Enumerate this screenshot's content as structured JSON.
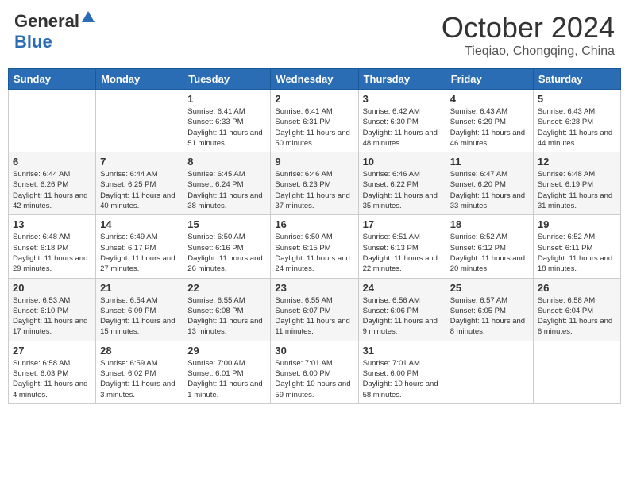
{
  "header": {
    "logo_general": "General",
    "logo_blue": "Blue",
    "month_title": "October 2024",
    "location": "Tieqiao, Chongqing, China"
  },
  "days_of_week": [
    "Sunday",
    "Monday",
    "Tuesday",
    "Wednesday",
    "Thursday",
    "Friday",
    "Saturday"
  ],
  "weeks": [
    [
      {
        "day": "",
        "sunrise": "",
        "sunset": "",
        "daylight": ""
      },
      {
        "day": "",
        "sunrise": "",
        "sunset": "",
        "daylight": ""
      },
      {
        "day": "1",
        "sunrise": "Sunrise: 6:41 AM",
        "sunset": "Sunset: 6:33 PM",
        "daylight": "Daylight: 11 hours and 51 minutes."
      },
      {
        "day": "2",
        "sunrise": "Sunrise: 6:41 AM",
        "sunset": "Sunset: 6:31 PM",
        "daylight": "Daylight: 11 hours and 50 minutes."
      },
      {
        "day": "3",
        "sunrise": "Sunrise: 6:42 AM",
        "sunset": "Sunset: 6:30 PM",
        "daylight": "Daylight: 11 hours and 48 minutes."
      },
      {
        "day": "4",
        "sunrise": "Sunrise: 6:43 AM",
        "sunset": "Sunset: 6:29 PM",
        "daylight": "Daylight: 11 hours and 46 minutes."
      },
      {
        "day": "5",
        "sunrise": "Sunrise: 6:43 AM",
        "sunset": "Sunset: 6:28 PM",
        "daylight": "Daylight: 11 hours and 44 minutes."
      }
    ],
    [
      {
        "day": "6",
        "sunrise": "Sunrise: 6:44 AM",
        "sunset": "Sunset: 6:26 PM",
        "daylight": "Daylight: 11 hours and 42 minutes."
      },
      {
        "day": "7",
        "sunrise": "Sunrise: 6:44 AM",
        "sunset": "Sunset: 6:25 PM",
        "daylight": "Daylight: 11 hours and 40 minutes."
      },
      {
        "day": "8",
        "sunrise": "Sunrise: 6:45 AM",
        "sunset": "Sunset: 6:24 PM",
        "daylight": "Daylight: 11 hours and 38 minutes."
      },
      {
        "day": "9",
        "sunrise": "Sunrise: 6:46 AM",
        "sunset": "Sunset: 6:23 PM",
        "daylight": "Daylight: 11 hours and 37 minutes."
      },
      {
        "day": "10",
        "sunrise": "Sunrise: 6:46 AM",
        "sunset": "Sunset: 6:22 PM",
        "daylight": "Daylight: 11 hours and 35 minutes."
      },
      {
        "day": "11",
        "sunrise": "Sunrise: 6:47 AM",
        "sunset": "Sunset: 6:20 PM",
        "daylight": "Daylight: 11 hours and 33 minutes."
      },
      {
        "day": "12",
        "sunrise": "Sunrise: 6:48 AM",
        "sunset": "Sunset: 6:19 PM",
        "daylight": "Daylight: 11 hours and 31 minutes."
      }
    ],
    [
      {
        "day": "13",
        "sunrise": "Sunrise: 6:48 AM",
        "sunset": "Sunset: 6:18 PM",
        "daylight": "Daylight: 11 hours and 29 minutes."
      },
      {
        "day": "14",
        "sunrise": "Sunrise: 6:49 AM",
        "sunset": "Sunset: 6:17 PM",
        "daylight": "Daylight: 11 hours and 27 minutes."
      },
      {
        "day": "15",
        "sunrise": "Sunrise: 6:50 AM",
        "sunset": "Sunset: 6:16 PM",
        "daylight": "Daylight: 11 hours and 26 minutes."
      },
      {
        "day": "16",
        "sunrise": "Sunrise: 6:50 AM",
        "sunset": "Sunset: 6:15 PM",
        "daylight": "Daylight: 11 hours and 24 minutes."
      },
      {
        "day": "17",
        "sunrise": "Sunrise: 6:51 AM",
        "sunset": "Sunset: 6:13 PM",
        "daylight": "Daylight: 11 hours and 22 minutes."
      },
      {
        "day": "18",
        "sunrise": "Sunrise: 6:52 AM",
        "sunset": "Sunset: 6:12 PM",
        "daylight": "Daylight: 11 hours and 20 minutes."
      },
      {
        "day": "19",
        "sunrise": "Sunrise: 6:52 AM",
        "sunset": "Sunset: 6:11 PM",
        "daylight": "Daylight: 11 hours and 18 minutes."
      }
    ],
    [
      {
        "day": "20",
        "sunrise": "Sunrise: 6:53 AM",
        "sunset": "Sunset: 6:10 PM",
        "daylight": "Daylight: 11 hours and 17 minutes."
      },
      {
        "day": "21",
        "sunrise": "Sunrise: 6:54 AM",
        "sunset": "Sunset: 6:09 PM",
        "daylight": "Daylight: 11 hours and 15 minutes."
      },
      {
        "day": "22",
        "sunrise": "Sunrise: 6:55 AM",
        "sunset": "Sunset: 6:08 PM",
        "daylight": "Daylight: 11 hours and 13 minutes."
      },
      {
        "day": "23",
        "sunrise": "Sunrise: 6:55 AM",
        "sunset": "Sunset: 6:07 PM",
        "daylight": "Daylight: 11 hours and 11 minutes."
      },
      {
        "day": "24",
        "sunrise": "Sunrise: 6:56 AM",
        "sunset": "Sunset: 6:06 PM",
        "daylight": "Daylight: 11 hours and 9 minutes."
      },
      {
        "day": "25",
        "sunrise": "Sunrise: 6:57 AM",
        "sunset": "Sunset: 6:05 PM",
        "daylight": "Daylight: 11 hours and 8 minutes."
      },
      {
        "day": "26",
        "sunrise": "Sunrise: 6:58 AM",
        "sunset": "Sunset: 6:04 PM",
        "daylight": "Daylight: 11 hours and 6 minutes."
      }
    ],
    [
      {
        "day": "27",
        "sunrise": "Sunrise: 6:58 AM",
        "sunset": "Sunset: 6:03 PM",
        "daylight": "Daylight: 11 hours and 4 minutes."
      },
      {
        "day": "28",
        "sunrise": "Sunrise: 6:59 AM",
        "sunset": "Sunset: 6:02 PM",
        "daylight": "Daylight: 11 hours and 3 minutes."
      },
      {
        "day": "29",
        "sunrise": "Sunrise: 7:00 AM",
        "sunset": "Sunset: 6:01 PM",
        "daylight": "Daylight: 11 hours and 1 minute."
      },
      {
        "day": "30",
        "sunrise": "Sunrise: 7:01 AM",
        "sunset": "Sunset: 6:00 PM",
        "daylight": "Daylight: 10 hours and 59 minutes."
      },
      {
        "day": "31",
        "sunrise": "Sunrise: 7:01 AM",
        "sunset": "Sunset: 6:00 PM",
        "daylight": "Daylight: 10 hours and 58 minutes."
      },
      {
        "day": "",
        "sunrise": "",
        "sunset": "",
        "daylight": ""
      },
      {
        "day": "",
        "sunrise": "",
        "sunset": "",
        "daylight": ""
      }
    ]
  ]
}
